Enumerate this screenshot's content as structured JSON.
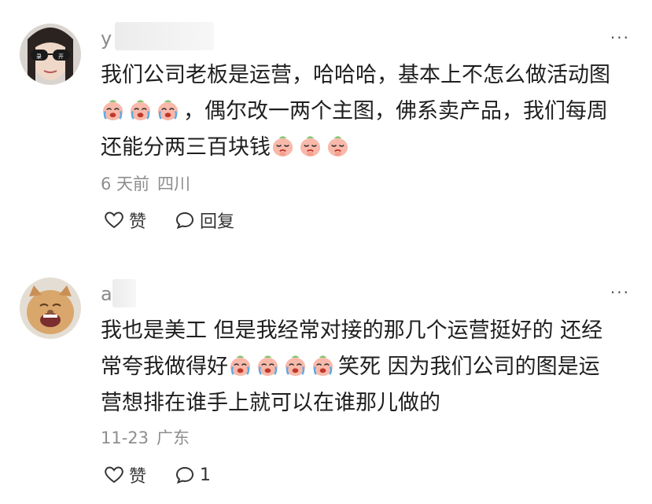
{
  "comments": [
    {
      "username": "y",
      "text": {
        "l1": "我们公司老板是运营，哈哈哈，基本上不怎么做活动图",
        "l2": "，偶尔改一两个主图，佛系卖产品，我们每周",
        "l3a": "还能分两三百块钱"
      },
      "emoji_l2": "crying-emoji",
      "emoji_l3": "pleading-emoji",
      "time": "6 天前",
      "location": "四川",
      "like_label": "赞",
      "reply_label": "回复"
    },
    {
      "username": "a",
      "text": {
        "l1": "我也是美工 但是我经常对接的那几个运营挺好的 还经",
        "l2a": "常夸我做得好",
        "l2b": "笑死 因为我们公司的图是运",
        "l3": "营想排在谁手上就可以在谁那儿做的"
      },
      "emoji_l2": "crying-emoji",
      "time": "11-23",
      "location": "广东",
      "like_label": "赞",
      "reply_count": "1"
    }
  ],
  "more_label": "···",
  "colors": {
    "text": "#1f1f1f",
    "meta": "#8e8e8e",
    "emoji_face": "#f6b3a6"
  }
}
